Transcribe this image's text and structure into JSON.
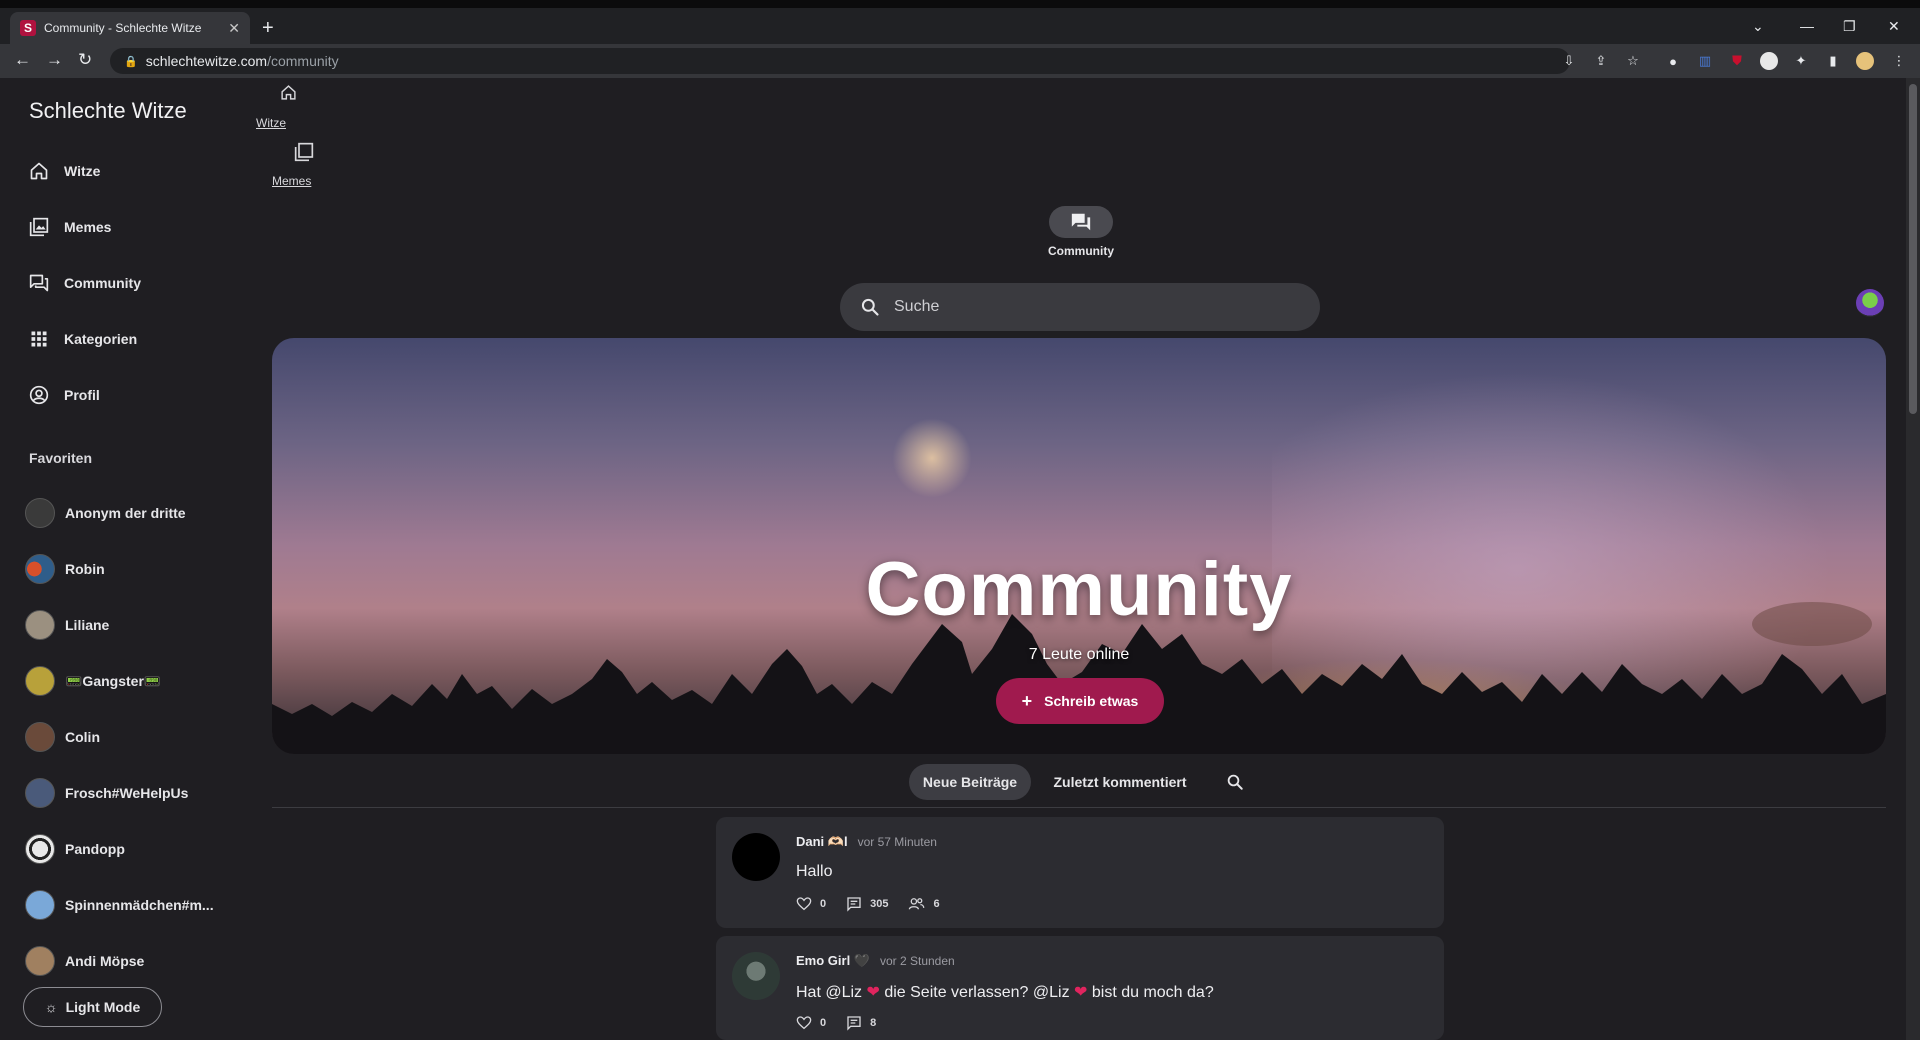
{
  "browser": {
    "tab_title": "Community - Schlechte Witze",
    "tab_favicon": "S",
    "url_host": "schlechtewitze.com",
    "url_path": "/community"
  },
  "sidebar": {
    "brand": "Schlechte Witze",
    "nav": [
      {
        "label": "Witze",
        "icon": "home-icon"
      },
      {
        "label": "Memes",
        "icon": "gallery-icon"
      },
      {
        "label": "Community",
        "icon": "forum-icon"
      },
      {
        "label": "Kategorien",
        "icon": "grid-icon"
      },
      {
        "label": "Profil",
        "icon": "account-circle-icon"
      }
    ],
    "favorites_title": "Favoriten",
    "favorites": [
      {
        "name": "Anonym der dritte",
        "color": "#3a3a3a"
      },
      {
        "name": "Robin",
        "color": "#2f5d8a"
      },
      {
        "name": "Liliane",
        "color": "#9b9080"
      },
      {
        "name": "📟Gangster📟",
        "color": "#b8a13a"
      },
      {
        "name": "Colin",
        "color": "#6a4a3a"
      },
      {
        "name": "Frosch#WeHelpUs",
        "color": "#4a5a7a"
      },
      {
        "name": "Pandopp",
        "color": "#e8e8e8"
      },
      {
        "name": "Spinnenmädchen#m...",
        "color": "#7aa8d8"
      },
      {
        "name": "Andi Möpse",
        "color": "#a08060"
      }
    ],
    "light_mode_label": "Light Mode"
  },
  "topnav": {
    "witze": "Witze",
    "memes": "Memes",
    "community": "Community"
  },
  "search": {
    "placeholder": "Suche"
  },
  "hero": {
    "title": "Community",
    "online": "7 Leute online",
    "button": "Schreib etwas"
  },
  "filters": {
    "new_posts": "Neue Beiträge",
    "recent_comments": "Zuletzt kommentiert"
  },
  "posts": [
    {
      "author": "Dani 🫶🏻l",
      "time": "vor 57 Minuten",
      "body": "Hallo",
      "likes": "0",
      "comments": "305",
      "participants": "6",
      "avatar_color": "#000000"
    },
    {
      "author": "Emo Girl 🖤",
      "time": "vor 2 Stunden",
      "body_parts": [
        "Hat @Liz ",
        "❤",
        " die Seite verlassen? @Liz ",
        "❤",
        " bist du moch da?"
      ],
      "likes": "0",
      "comments": "8",
      "avatar_color": "#2e3a36"
    }
  ],
  "colors": {
    "accent": "#a01a4e",
    "background": "#1f1e22",
    "card": "#2c2c31"
  }
}
